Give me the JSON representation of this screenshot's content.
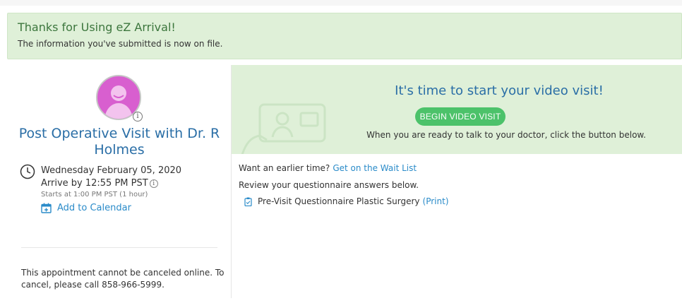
{
  "banner": {
    "title": "Thanks for Using eZ Arrival!",
    "message": "The information you've submitted is now on file."
  },
  "appointment": {
    "title": "Post Operative Visit with Dr. R Holmes",
    "date": "Wednesday February 05, 2020",
    "arrive_by": "Arrive by 12:55 PM PST",
    "starts_at": "Starts at 1:00 PM PST (1 hour)",
    "add_to_calendar": "Add to Calendar",
    "cancel_note": "This appointment cannot be canceled online. To cancel, please call 858-966-5999."
  },
  "video": {
    "heading": "It's time to start your video visit!",
    "button_label": "BEGIN VIDEO VISIT",
    "note": "When you are ready to talk to your doctor, click the button below."
  },
  "content": {
    "earlier_prompt": "Want an earlier time?",
    "wait_list_link": "Get on the Wait List",
    "review_text": "Review your questionnaire answers below.",
    "questionnaire_name": "Pre-Visit Questionnaire Plastic Surgery",
    "print_link": "(Print)"
  },
  "colors": {
    "banner_bg": "#dff0d8",
    "title_blue": "#2a6ea6",
    "link_blue": "#2a8bc9",
    "button_green": "#4cc26a",
    "avatar_pink": "#d85fcf"
  },
  "icons": [
    "user-avatar-icon",
    "info-icon",
    "clock-icon",
    "calendar-add-icon",
    "clipboard-icon",
    "video-call-illustration"
  ]
}
